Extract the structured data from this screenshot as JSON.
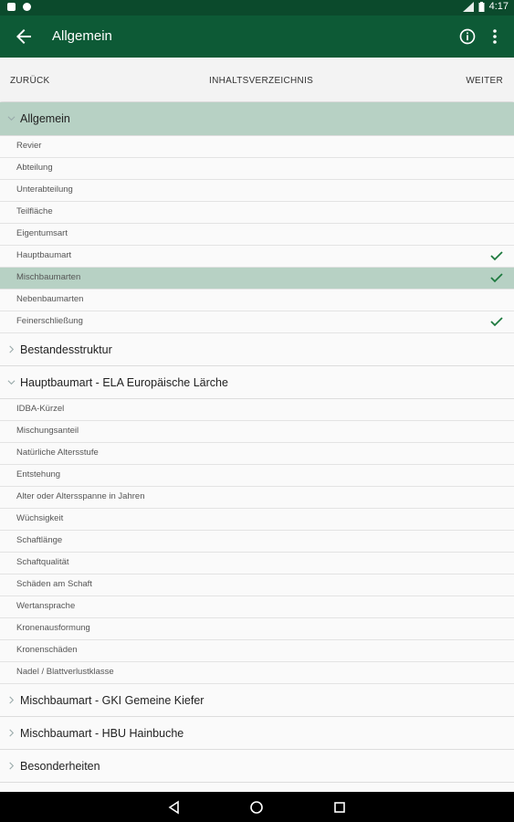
{
  "status": {
    "time": "4:17"
  },
  "appbar": {
    "title": "Allgemein"
  },
  "navrow": {
    "back": "ZURÜCK",
    "toc": "INHALTSVERZEICHNIS",
    "next": "WEITER"
  },
  "sections": [
    {
      "label": "Allgemein",
      "expanded": true,
      "active": true,
      "items": [
        {
          "label": "Revier",
          "check": false,
          "selected": false
        },
        {
          "label": "Abteilung",
          "check": false,
          "selected": false
        },
        {
          "label": "Unterabteilung",
          "check": false,
          "selected": false
        },
        {
          "label": "Teilfläche",
          "check": false,
          "selected": false
        },
        {
          "label": "Eigentumsart",
          "check": false,
          "selected": false
        },
        {
          "label": "Hauptbaumart",
          "check": true,
          "selected": false
        },
        {
          "label": "Mischbaumarten",
          "check": true,
          "selected": true
        },
        {
          "label": "Nebenbaumarten",
          "check": false,
          "selected": false
        },
        {
          "label": "Feinerschließung",
          "check": true,
          "selected": false
        }
      ]
    },
    {
      "label": "Bestandesstruktur",
      "expanded": false,
      "active": false,
      "items": []
    },
    {
      "label": "Hauptbaumart - ELA Europäische Lärche",
      "expanded": true,
      "active": false,
      "items": [
        {
          "label": "IDBA-Kürzel",
          "check": false,
          "selected": false
        },
        {
          "label": "Mischungsanteil",
          "check": false,
          "selected": false
        },
        {
          "label": "Natürliche Altersstufe",
          "check": false,
          "selected": false
        },
        {
          "label": "Entstehung",
          "check": false,
          "selected": false
        },
        {
          "label": "Alter oder Altersspanne in Jahren",
          "check": false,
          "selected": false
        },
        {
          "label": "Wüchsigkeit",
          "check": false,
          "selected": false
        },
        {
          "label": "Schaftlänge",
          "check": false,
          "selected": false
        },
        {
          "label": "Schaftqualität",
          "check": false,
          "selected": false
        },
        {
          "label": "Schäden am Schaft",
          "check": false,
          "selected": false
        },
        {
          "label": "Wertansprache",
          "check": false,
          "selected": false
        },
        {
          "label": "Kronenausformung",
          "check": false,
          "selected": false
        },
        {
          "label": "Kronenschäden",
          "check": false,
          "selected": false
        },
        {
          "label": "Nadel / Blattverlustklasse",
          "check": false,
          "selected": false
        }
      ]
    },
    {
      "label": "Mischbaumart - GKI Gemeine Kiefer",
      "expanded": false,
      "active": false,
      "items": []
    },
    {
      "label": "Mischbaumart - HBU Hainbuche",
      "expanded": false,
      "active": false,
      "items": []
    },
    {
      "label": "Besonderheiten",
      "expanded": false,
      "active": false,
      "items": []
    }
  ],
  "colors": {
    "statusbar": "#0b4a2c",
    "appbar": "#0d5a36",
    "selected": "#b7d1c4",
    "check": "#1e7a3f"
  },
  "icons": {
    "back": "arrow-back-icon",
    "info": "info-icon",
    "more": "more-vert-icon",
    "check": "check-icon"
  }
}
